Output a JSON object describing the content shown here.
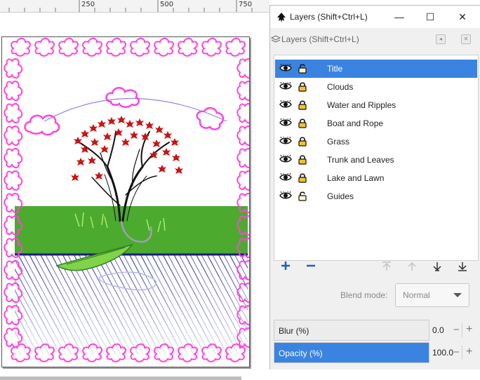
{
  "ruler": {
    "labels": [
      "250",
      "500",
      "750"
    ]
  },
  "dialog": {
    "window_title": "Layers (Shift+Ctrl+L)",
    "dock_title": "Layers (Shift+Ctrl+L)",
    "window_buttons": {
      "minimize": "—",
      "maximize": "☐",
      "close": "✕"
    }
  },
  "layers": [
    {
      "name": "Title",
      "visible": true,
      "locked": false,
      "selected": true
    },
    {
      "name": "Clouds",
      "visible": true,
      "locked": true,
      "selected": false
    },
    {
      "name": "Water and Ripples",
      "visible": true,
      "locked": true,
      "selected": false
    },
    {
      "name": "Boat and Rope",
      "visible": true,
      "locked": true,
      "selected": false
    },
    {
      "name": "Grass",
      "visible": true,
      "locked": true,
      "selected": false
    },
    {
      "name": "Trunk and Leaves",
      "visible": true,
      "locked": true,
      "selected": false
    },
    {
      "name": "Lake and Lawn",
      "visible": true,
      "locked": true,
      "selected": false
    },
    {
      "name": "Guides",
      "visible": true,
      "locked": false,
      "selected": false
    }
  ],
  "blend": {
    "label": "Blend mode:",
    "value": "Normal"
  },
  "blur": {
    "label": "Blur (%)",
    "value": "0.0",
    "fraction": 0.0
  },
  "opacity": {
    "label": "Opacity (%)",
    "value": "100.0",
    "fraction": 1.0
  },
  "colors": {
    "accent": "#3b83e0",
    "border_cloud": "#ff44dd",
    "lawn": "#4caa2e",
    "water": "#2a2d93",
    "leaves": "#c91414"
  }
}
